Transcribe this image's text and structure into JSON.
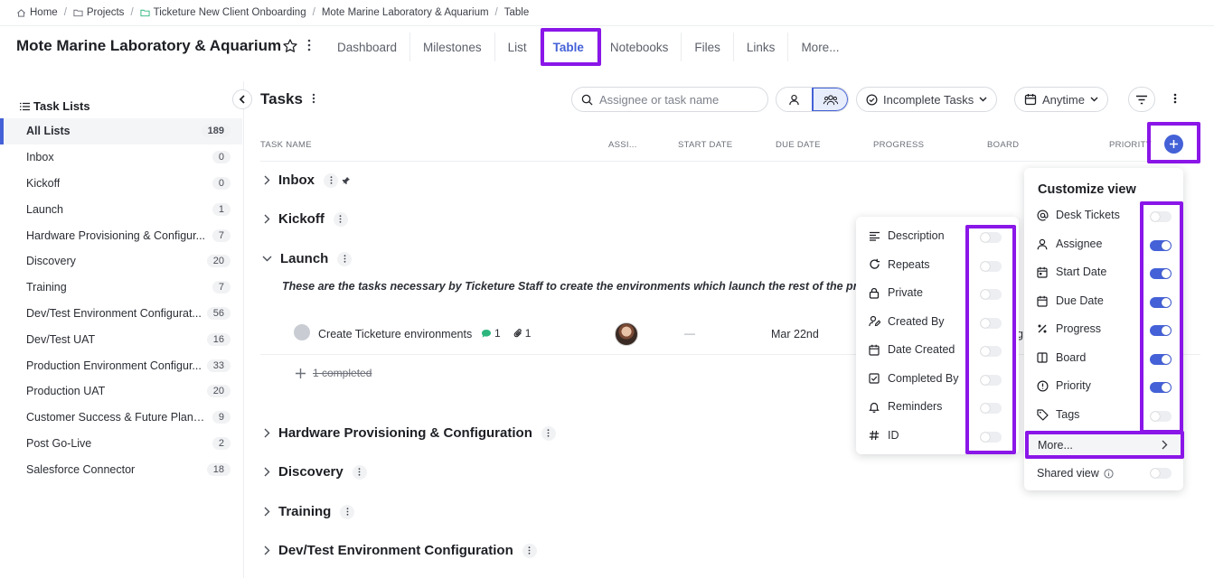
{
  "breadcrumb": [
    "Home",
    "Projects",
    "Ticketure New Client Onboarding",
    "Mote Marine Laboratory & Aquarium",
    "Table"
  ],
  "project": {
    "title": "Mote Marine Laboratory & Aquarium",
    "tabs": [
      "Dashboard",
      "Milestones",
      "List",
      "Table",
      "Notebooks",
      "Files",
      "Links",
      "More..."
    ]
  },
  "sidebar": {
    "title": "Task Lists",
    "items": [
      {
        "label": "All Lists",
        "count": "189"
      },
      {
        "label": "Inbox",
        "count": "0"
      },
      {
        "label": "Kickoff",
        "count": "0"
      },
      {
        "label": "Launch",
        "count": "1"
      },
      {
        "label": "Hardware Provisioning & Configur...",
        "count": "7"
      },
      {
        "label": "Discovery",
        "count": "20"
      },
      {
        "label": "Training",
        "count": "7"
      },
      {
        "label": "Dev/Test Environment Configurat...",
        "count": "56"
      },
      {
        "label": "Dev/Test UAT",
        "count": "16"
      },
      {
        "label": "Production Environment Configur...",
        "count": "33"
      },
      {
        "label": "Production UAT",
        "count": "20"
      },
      {
        "label": "Customer Success & Future Plann...",
        "count": "9"
      },
      {
        "label": "Post Go-Live",
        "count": "2"
      },
      {
        "label": "Salesforce Connector",
        "count": "18"
      }
    ]
  },
  "toolbar": {
    "title": "Tasks",
    "search_placeholder": "Assignee or task name",
    "status_filter": "Incomplete Tasks",
    "date_filter": "Anytime"
  },
  "columns": [
    "TASK NAME",
    "ASSI...",
    "START DATE",
    "DUE DATE",
    "PROGRESS",
    "BOARD",
    "PRIORITY"
  ],
  "groups": {
    "inbox": "Inbox",
    "kickoff": "Kickoff",
    "launch": "Launch",
    "launch_description": "These are the tasks necessary by Ticketure Staff to create the environments which launch the rest of the project",
    "hardware": "Hardware Provisioning & Configuration",
    "discovery": "Discovery",
    "training": "Training",
    "devtest": "Dev/Test Environment Configuration"
  },
  "task": {
    "name": "Create Ticketure environments",
    "comments": "1",
    "attachments": "1",
    "start_date": "—",
    "due_date": "Mar 22nd",
    "board_partial": "og"
  },
  "completed_label": "1 completed",
  "field_menu": [
    {
      "label": "Description",
      "icon": "description-icon",
      "on": false
    },
    {
      "label": "Repeats",
      "icon": "repeat-icon",
      "on": false
    },
    {
      "label": "Private",
      "icon": "lock-icon",
      "on": false
    },
    {
      "label": "Created By",
      "icon": "user-edit-icon",
      "on": false
    },
    {
      "label": "Date Created",
      "icon": "calendar-icon",
      "on": false
    },
    {
      "label": "Completed By",
      "icon": "check-square-icon",
      "on": false
    },
    {
      "label": "Reminders",
      "icon": "bell-icon",
      "on": false
    },
    {
      "label": "ID",
      "icon": "hash-icon",
      "on": false
    }
  ],
  "customize": {
    "title": "Customize view",
    "items": [
      {
        "label": "Desk Tickets",
        "icon": "at-icon",
        "on": false
      },
      {
        "label": "Assignee",
        "icon": "user-icon",
        "on": true
      },
      {
        "label": "Start Date",
        "icon": "calendar-start-icon",
        "on": true
      },
      {
        "label": "Due Date",
        "icon": "calendar-icon",
        "on": true
      },
      {
        "label": "Progress",
        "icon": "percent-icon",
        "on": true
      },
      {
        "label": "Board",
        "icon": "board-icon",
        "on": true
      },
      {
        "label": "Priority",
        "icon": "priority-icon",
        "on": true
      },
      {
        "label": "Tags",
        "icon": "tag-icon",
        "on": false
      }
    ],
    "more_label": "More...",
    "shared_view_label": "Shared view",
    "shared_view_on": false
  },
  "colors": {
    "accent": "#4461d7",
    "highlight": "#8a16e8",
    "comment": "#2cb67d"
  }
}
